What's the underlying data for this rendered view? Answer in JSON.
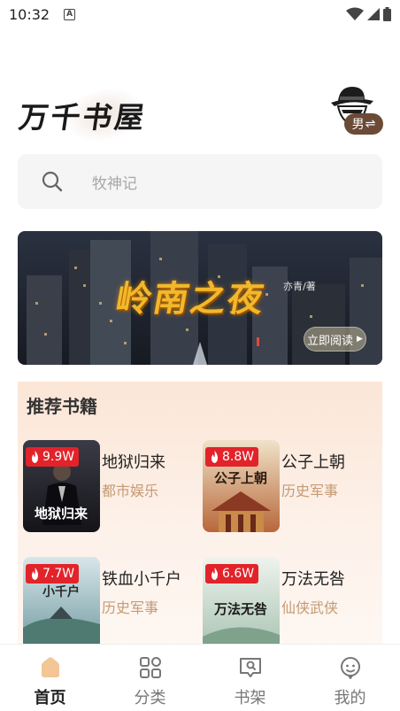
{
  "status_bar": {
    "time": "10:32",
    "a_badge": "A"
  },
  "header": {
    "app_name": "万千书屋",
    "gender_label": "男",
    "switch_glyph": "⇌"
  },
  "search": {
    "placeholder": "牧神记"
  },
  "banner": {
    "title": "岭南之夜",
    "author": "亦青/著",
    "read_label": "立即阅读",
    "read_arrow": "▶"
  },
  "recommend": {
    "section_title": "推荐书籍",
    "books": [
      {
        "heat": "9.9W",
        "name": "地狱归来",
        "category": "都市娱乐",
        "cover_text": "地狱归来"
      },
      {
        "heat": "8.8W",
        "name": "公子上朝",
        "category": "历史军事",
        "cover_text": "公子上朝"
      },
      {
        "heat": "7.7W",
        "name": "铁血小千户",
        "category": "历史军事",
        "cover_text": "小千户"
      },
      {
        "heat": "6.6W",
        "name": "万法无咎",
        "category": "仙侠武侠",
        "cover_text": "万法无咎"
      }
    ]
  },
  "tabbar": {
    "tabs": [
      {
        "label": "首页",
        "icon": "home-icon",
        "active": true
      },
      {
        "label": "分类",
        "icon": "category-grid-icon",
        "active": false
      },
      {
        "label": "书架",
        "icon": "bookshelf-icon",
        "active": false
      },
      {
        "label": "我的",
        "icon": "profile-icon",
        "active": false
      }
    ]
  },
  "colors": {
    "accent": "#f4c595",
    "heat_badge": "#e2232a",
    "category_text": "#c49a74",
    "gender_badge": "#6b4a36",
    "recommend_bg": "#fbe6d7"
  }
}
